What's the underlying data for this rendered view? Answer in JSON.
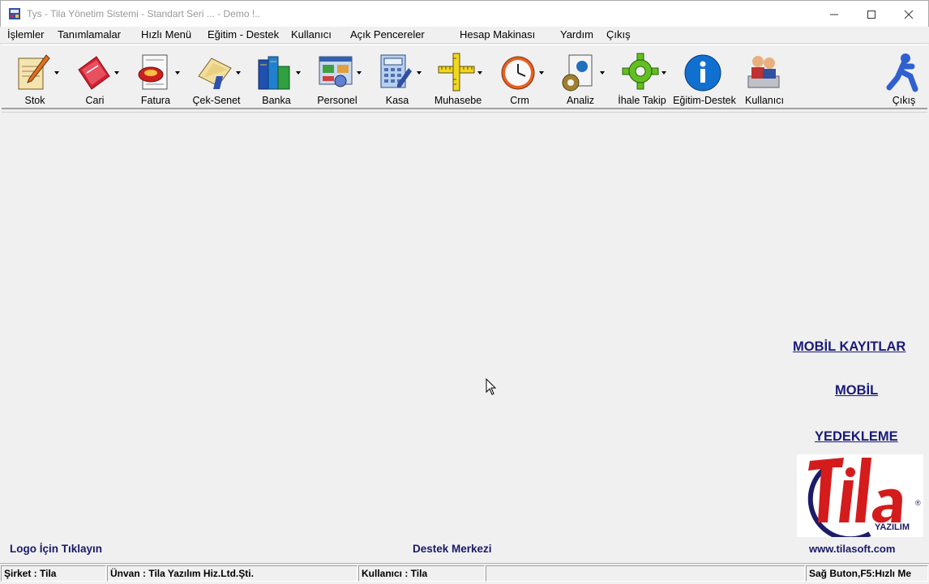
{
  "window": {
    "title": "Tys - Tila Yönetim Sistemi - Standart Seri ... - Demo !..",
    "minimize_icon": "minimize-icon",
    "maximize_icon": "maximize-icon",
    "close_icon": "close-icon"
  },
  "menu": {
    "items": [
      "İşlemler",
      "Tanımlamalar",
      "Hızlı Menü",
      "Eğitim - Destek",
      "Kullanıcı",
      "Açık Pencereler",
      "Hesap Makinası",
      "Yardım",
      "Çıkış"
    ]
  },
  "toolbar": {
    "buttons": [
      {
        "label": "Stok",
        "icon": "notepad-pencil-icon",
        "color": "#d8a040"
      },
      {
        "label": "Cari",
        "icon": "red-card-icon",
        "color": "#d42030"
      },
      {
        "label": "Fatura",
        "icon": "invoice-stamp-icon",
        "color": "#cc2020"
      },
      {
        "label": "Çek-Senet",
        "icon": "check-pen-icon",
        "color": "#e0c060"
      },
      {
        "label": "Banka",
        "icon": "books-icon",
        "color": "#2060c0"
      },
      {
        "label": "Personel",
        "icon": "personnel-window-icon",
        "color": "#4080c0"
      },
      {
        "label": "Kasa",
        "icon": "calculator-icon",
        "color": "#5090d0"
      },
      {
        "label": "Muhasebe",
        "icon": "ruler-cross-icon",
        "color": "#e8d020"
      },
      {
        "label": "Crm",
        "icon": "clock-icon",
        "color": "#e05020"
      },
      {
        "label": "Analiz",
        "icon": "document-gears-icon",
        "color": "#3070b0"
      },
      {
        "label": "İhale Takip",
        "icon": "green-gear-icon",
        "color": "#60c020"
      },
      {
        "label": "Eğitim-Destek",
        "icon": "info-icon",
        "color": "#1070d0"
      },
      {
        "label": "Kullanıcı",
        "icon": "users-icon",
        "color": "#c03030"
      },
      {
        "label": "Çıkış",
        "icon": "running-man-icon",
        "color": "#3060d0"
      }
    ]
  },
  "links": {
    "mobil_kayitlar": "MOBİL KAYITLAR",
    "mobil": "MOBİL",
    "yedekleme": "YEDEKLEME"
  },
  "logo": {
    "brand": "Tila",
    "sub": "YAZILIM",
    "registered": "®"
  },
  "bottom": {
    "logo_link": "Logo İçin Tıklayın",
    "support": "Destek Merkezi",
    "website": "www.tilasoft.com"
  },
  "status": {
    "company": "Şirket : Tila",
    "title": "Ünvan : Tila Yazılım Hiz.Ltd.Şti.",
    "user": "Kullanıcı : Tila",
    "empty": "",
    "hint": "Sağ Buton,F5:Hızlı Me"
  },
  "colors": {
    "link": "#1a1a7a",
    "logo_red": "#d41c1c",
    "logo_navy": "#1c1c6a"
  }
}
